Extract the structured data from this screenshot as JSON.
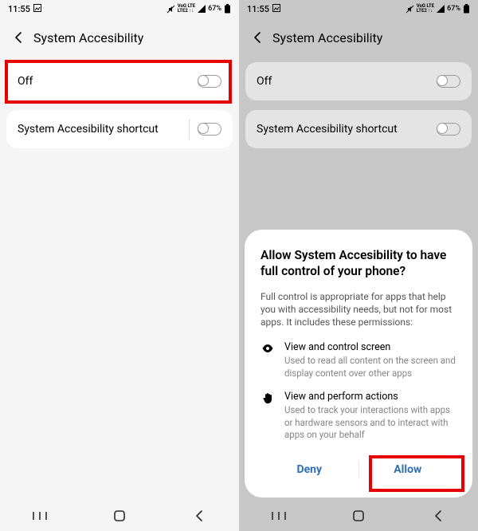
{
  "status": {
    "time": "11:55",
    "battery": "67%"
  },
  "header": {
    "title": "System Accesibility"
  },
  "rows": {
    "off_label": "Off",
    "shortcut_label": "System Accesibility shortcut"
  },
  "dialog": {
    "title": "Allow System Accesibility to have full control of your phone?",
    "description": "Full control is appropriate for apps that help you with accessibility needs, but not for most apps. It includes these permissions:",
    "perm1": {
      "title": "View and control screen",
      "text": "Used to read all content on the screen and display content over other apps"
    },
    "perm2": {
      "title": "View and perform actions",
      "text": "Used to track your interactions with apps or hardware sensors and to interact with apps on your behalf"
    },
    "deny": "Deny",
    "allow": "Allow"
  }
}
